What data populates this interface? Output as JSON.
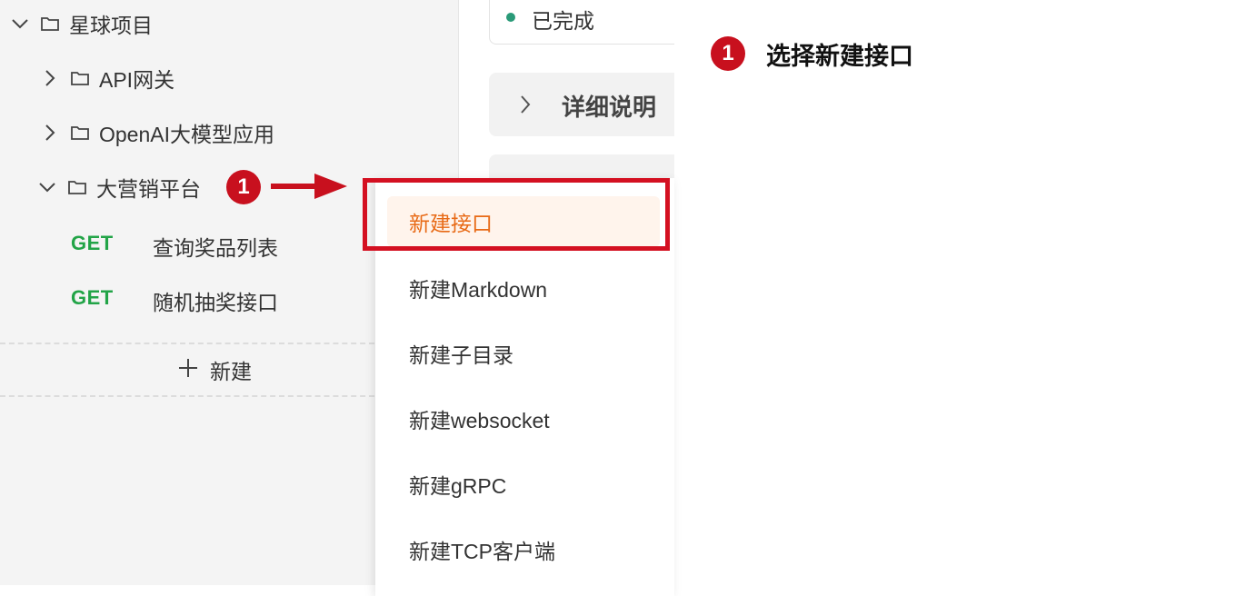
{
  "sidebar": {
    "tree": [
      {
        "label": "星球项目",
        "expanded": true
      },
      {
        "label": "API网关",
        "expanded": false
      },
      {
        "label": "OpenAI大模型应用",
        "expanded": false
      },
      {
        "label": "大营销平台",
        "expanded": true
      }
    ],
    "apis": [
      {
        "method": "GET",
        "name": "查询奖品列表"
      },
      {
        "method": "GET",
        "name": "随机抽奖接口"
      }
    ],
    "new_label": "新建"
  },
  "content": {
    "status": "已完成",
    "detail_title": "详细说明"
  },
  "menu": {
    "items": [
      "新建接口",
      "新建Markdown",
      "新建子目录",
      "新建websocket",
      "新建gRPC",
      "新建TCP客户端"
    ],
    "active_index": 0
  },
  "annotations": {
    "step_number": "1",
    "callout_text": "选择新建接口",
    "color": "#c8101e"
  },
  "colors": {
    "get_method": "#22a447",
    "accent_orange": "#e86a16",
    "status_green": "#2a9a78"
  }
}
